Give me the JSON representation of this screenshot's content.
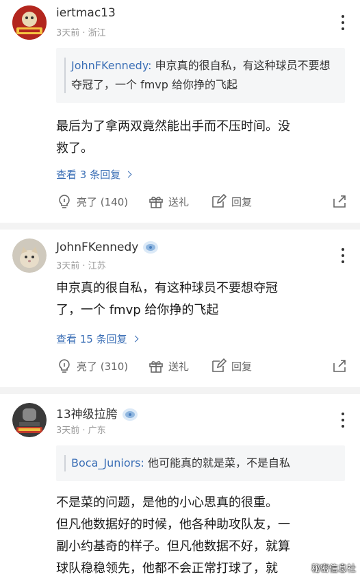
{
  "comments": [
    {
      "username": "iertmac13",
      "meta": "3天前 · 浙江",
      "quote_user": "JohnFKennedy:",
      "quote_text": " 申京真的很自私，有这种球员不要想夺冠了，一个 fmvp 给你挣的飞起",
      "text_line1": "最后为了拿两双竟然能出手而不压时间。没",
      "text_line2": "救了。",
      "replies": "查看 3 条回复",
      "like": "亮了 (140)",
      "gift": "送礼",
      "reply": "回复"
    },
    {
      "username": "JohnFKennedy",
      "meta": "3天前 · 江苏",
      "text_line1": "申京真的很自私，有这种球员不要想夺冠",
      "text_line2": "了，一个 fmvp 给你挣的飞起",
      "replies": "查看 15 条回复",
      "like": "亮了 (310)",
      "gift": "送礼",
      "reply": "回复"
    },
    {
      "username": "13神级拉胯",
      "meta": "3天前 · 广东",
      "quote_user": "Boca_Juniors:",
      "quote_text": " 他可能真的就是菜，不是自私",
      "text_line1": "不是菜的问题，是他的小心思真的很重。",
      "text_line2": "但凡他数据好的时候，他各种助攻队友，一",
      "text_line3": "副小约基奇的样子。但凡他数据不好，就算",
      "text_line4": "球队稳稳领先，他都不会正常打球了，就"
    }
  ],
  "watermark": "秘密信息社",
  "colors": {
    "link": "#3b6fb6",
    "meta": "#999999",
    "divider": "#f3f3f3"
  }
}
